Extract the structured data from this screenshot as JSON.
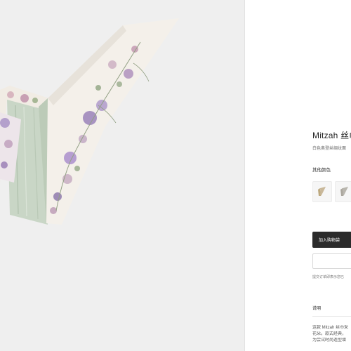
{
  "product": {
    "title": "Mitzah 丝巾",
    "subtitle": "白色奥登丝绸纹面",
    "other_colors_label": "其他颜色",
    "swatches": [
      {
        "name": "swatch-beige",
        "color": "#c9b89a"
      },
      {
        "name": "swatch-grey",
        "color": "#b9b6ae"
      }
    ],
    "add_to_bag_label": "加入购物袋",
    "notice": "提交订单即表示您已",
    "description_heading": "说明",
    "description_lines": [
      "这款 Mitzah 丝巾采",
      "花朵。款式经典，",
      "为尝试时尚造型增"
    ]
  },
  "colors": {
    "gallery_bg": "#efefef",
    "scarf_cream": "#f4f0ea",
    "scarf_green": "#c9d6c6",
    "button_dark": "#2b2b2b"
  }
}
